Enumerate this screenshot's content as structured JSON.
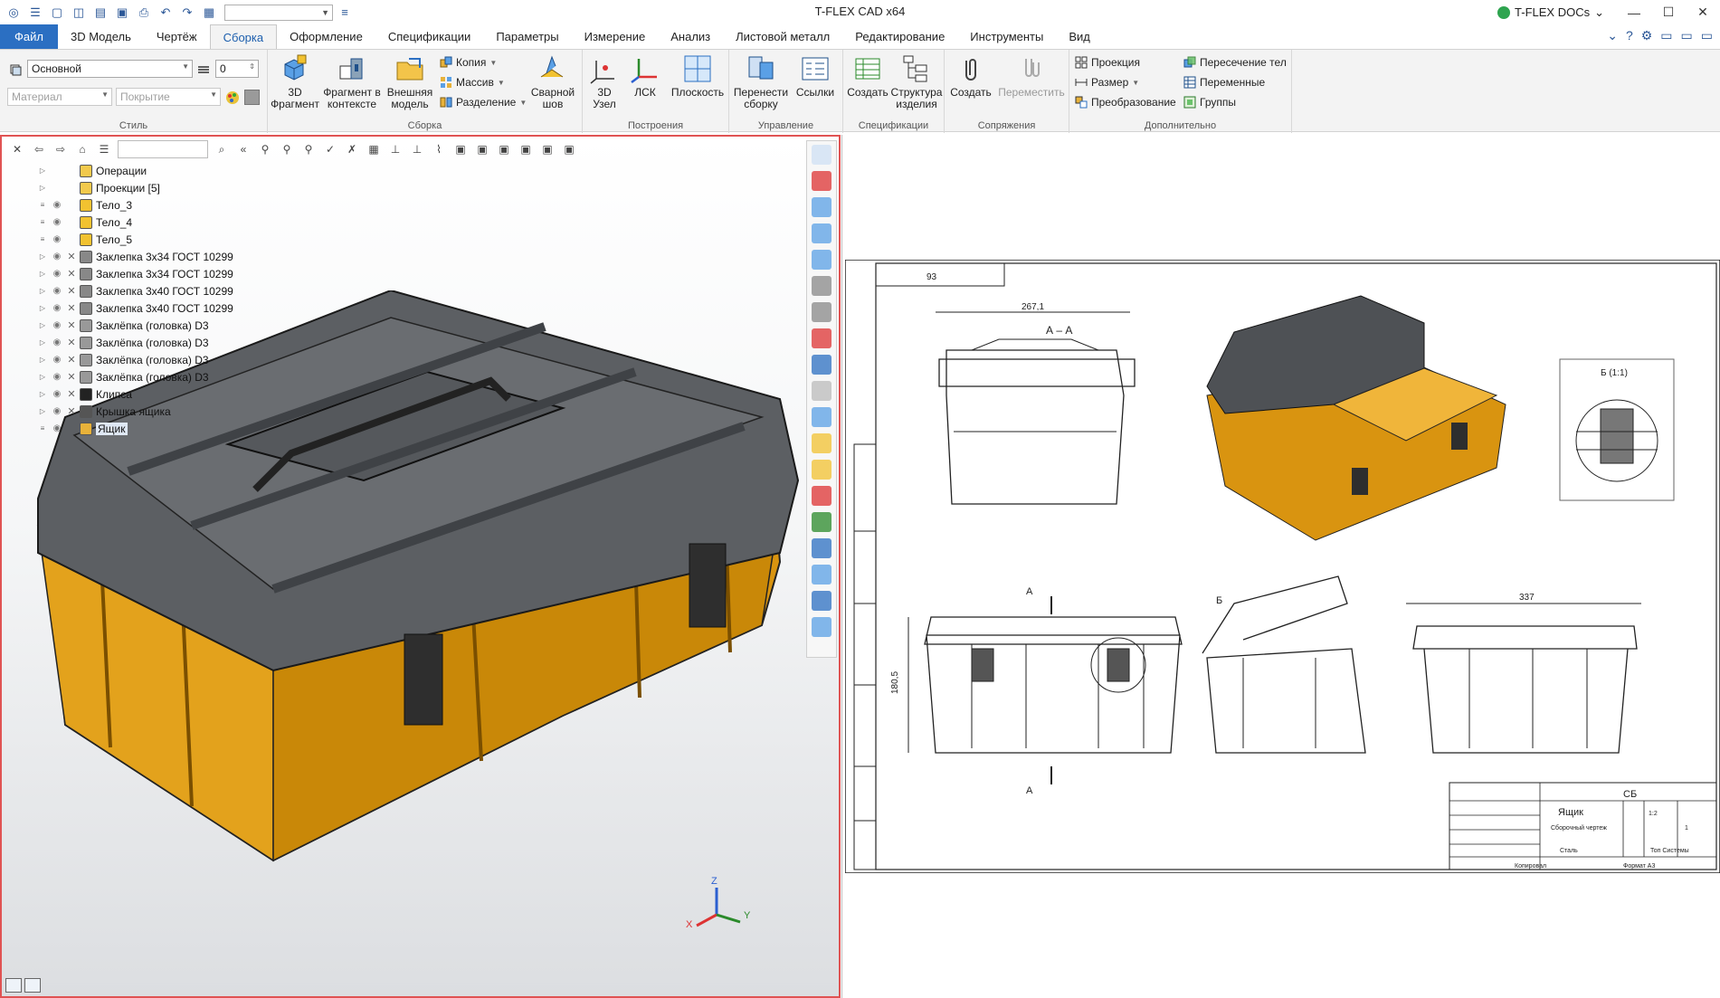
{
  "app": {
    "title": "T-FLEX CAD x64",
    "docs_label": "T-FLEX DOCs",
    "docs_chevron": "⌄"
  },
  "menu_tabs": [
    "Файл",
    "3D Модель",
    "Чертёж",
    "Сборка",
    "Оформление",
    "Спецификации",
    "Параметры",
    "Измерение",
    "Анализ",
    "Листовой металл",
    "Редактирование",
    "Инструменты",
    "Вид"
  ],
  "active_tab": "Сборка",
  "ribbon": {
    "style": {
      "label": "Стиль",
      "layer": "Основной",
      "layer_num": "0",
      "material_placeholder": "Материал",
      "coating_placeholder": "Покрытие"
    },
    "assembly": {
      "label": "Сборка",
      "fragment3d": "3D Фрагмент",
      "fragment_ctx": "Фрагмент в контексте",
      "external_model": "Внешняя модель",
      "copy": "Копия",
      "array": "Массив",
      "split": "Разделение",
      "weld_seam": "Сварной шов"
    },
    "constructions": {
      "label": "Построения",
      "node3d": "3D Узел",
      "lcs": "ЛСК",
      "plane": "Плоскость"
    },
    "management": {
      "label": "Управление",
      "move_assembly": "Перенести сборку",
      "links": "Ссылки"
    },
    "specs": {
      "label": "Спецификации",
      "create": "Создать",
      "structure": "Структура изделия"
    },
    "mates": {
      "label": "Сопряжения",
      "create": "Создать",
      "move": "Переместить"
    },
    "extra": {
      "label": "Дополнительно",
      "projection": "Проекция",
      "dimension": "Размер",
      "transform": "Преобразование",
      "body_intersection": "Пересечение тел",
      "variables": "Переменные",
      "groups": "Группы"
    }
  },
  "tree": [
    {
      "label": "Операции",
      "icon": "folder-icon",
      "expand": true,
      "eye": false,
      "cross": false
    },
    {
      "label": "Проекции [5]",
      "icon": "folder-icon",
      "expand": true,
      "eye": false,
      "cross": false
    },
    {
      "label": "Тело_3",
      "icon": "body-icon",
      "expand": false,
      "eye": true,
      "cross": false
    },
    {
      "label": "Тело_4",
      "icon": "body-icon",
      "expand": false,
      "eye": true,
      "cross": false
    },
    {
      "label": "Тело_5",
      "icon": "body-icon",
      "expand": false,
      "eye": true,
      "cross": false
    },
    {
      "label": "Заклепка 3x34 ГОСТ 10299",
      "icon": "rivet-icon",
      "expand": true,
      "eye": true,
      "cross": true
    },
    {
      "label": "Заклепка 3x34 ГОСТ 10299",
      "icon": "rivet-icon",
      "expand": true,
      "eye": true,
      "cross": true
    },
    {
      "label": "Заклепка 3x40 ГОСТ 10299",
      "icon": "rivet-icon",
      "expand": true,
      "eye": true,
      "cross": true
    },
    {
      "label": "Заклепка 3x40 ГОСТ 10299",
      "icon": "rivet-icon",
      "expand": true,
      "eye": true,
      "cross": true
    },
    {
      "label": "Заклёпка (головка) D3",
      "icon": "rivet-head-icon",
      "expand": true,
      "eye": true,
      "cross": true
    },
    {
      "label": "Заклёпка (головка) D3",
      "icon": "rivet-head-icon",
      "expand": true,
      "eye": true,
      "cross": true
    },
    {
      "label": "Заклёпка (головка) D3",
      "icon": "rivet-head-icon",
      "expand": true,
      "eye": true,
      "cross": true
    },
    {
      "label": "Заклёпка (головка) D3",
      "icon": "rivet-head-icon",
      "expand": true,
      "eye": true,
      "cross": true
    },
    {
      "label": "Клипса",
      "icon": "clip-icon",
      "expand": true,
      "eye": true,
      "cross": true
    },
    {
      "label": "Крышка ящика",
      "icon": "lid-icon",
      "expand": true,
      "eye": true,
      "cross": true
    },
    {
      "label": "Ящик",
      "icon": "box-icon",
      "expand": false,
      "eye": true,
      "cross": false
    }
  ],
  "drawing": {
    "section_label": "А – А",
    "dim_width": "267,1",
    "dim_length": "337",
    "dim_height": "180,5",
    "cut_a": "А",
    "cut_b": "Б",
    "detail_label": "Б (1:1)",
    "top_box_text": "93",
    "title_block": {
      "code": "СБ",
      "name": "Ящик",
      "subtitle": "Сборочный чертеж",
      "material": "Сталь",
      "company": "Топ Системы",
      "scale": "1:2",
      "sheet": "1",
      "copied": "Копировал",
      "format": "Формат   А3"
    }
  },
  "axes": {
    "x": "X",
    "y": "Y",
    "z": "Z"
  },
  "colors": {
    "accent": "#2b6fc2",
    "body_orange": "#d99410",
    "lid_gray": "#5c5f63",
    "panel_border": "#e05353"
  }
}
